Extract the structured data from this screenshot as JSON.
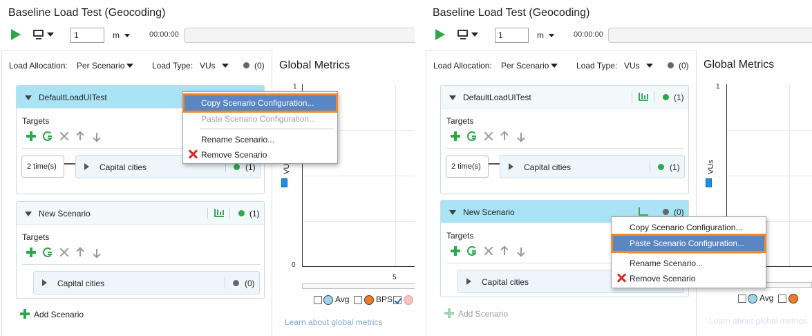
{
  "app": {
    "title": "Baseline Load Test (Geocoding)"
  },
  "toolbar": {
    "duration_value": "1",
    "duration_unit": "m",
    "timer": "00:00:00"
  },
  "left_pane": {
    "allocation_label": "Load Allocation:",
    "allocation_value": "Per Scenario",
    "load_type_label": "Load Type:",
    "load_type_value": "VUs",
    "total_count": "(0)"
  },
  "left_panel": {
    "scenarios": [
      {
        "name": "DefaultLoadUITest",
        "targets_label": "Targets",
        "times": "2 time(s)",
        "target_name": "Capital cities",
        "target_count": "(1)"
      },
      {
        "name": "New Scenario",
        "count": "(1)",
        "targets_label": "Targets",
        "target_name": "Capital cities",
        "target_count": "(0)"
      }
    ],
    "context_menu": {
      "items": [
        "Copy Scenario Configuration...",
        "Paste Scenario Configuration...",
        "Rename Scenario...",
        "Remove Scenario"
      ],
      "highlighted": 0,
      "disabled": [
        1
      ]
    }
  },
  "right_panel": {
    "scenarios": [
      {
        "name": "DefaultLoadUITest",
        "count": "(1)",
        "targets_label": "Targets",
        "times": "2 time(s)",
        "target_name": "Capital cities",
        "target_count": "(1)"
      },
      {
        "name": "New Scenario",
        "count": "(0)",
        "targets_label": "Targets",
        "target_name": "Capital cities"
      }
    ],
    "context_menu": {
      "items": [
        "Copy Scenario Configuration...",
        "Paste Scenario Configuration...",
        "Rename Scenario...",
        "Remove Scenario"
      ],
      "highlighted": 1,
      "disabled": []
    }
  },
  "add_scenario_label": "Add Scenario",
  "global_metrics": {
    "title": "Global Metrics",
    "ylabel": "VUs",
    "y_ticks": [
      "1",
      "0"
    ],
    "x_tick": "5",
    "legend": [
      "Avg",
      "BPS"
    ],
    "learn_link": "Learn about global metrics"
  },
  "colors": {
    "accent_green": "#2aa84a",
    "selected_header": "#a9e3f5",
    "menu_highlight": "#5b86c2",
    "focus_frame": "#f0892a",
    "remove_red": "#e02424"
  }
}
